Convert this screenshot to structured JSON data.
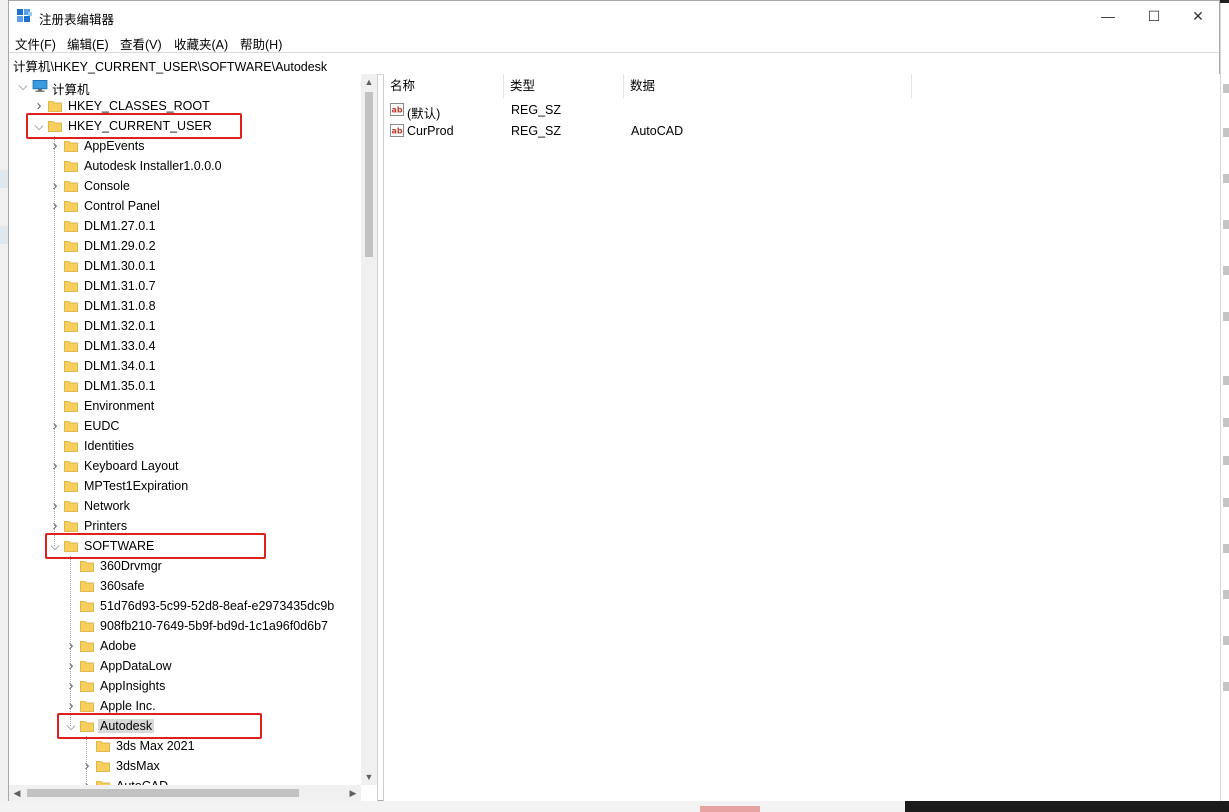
{
  "window": {
    "title": "注册表编辑器",
    "controls": {
      "minimize": "—",
      "maximize": "☐",
      "close": "✕"
    }
  },
  "menu": [
    "文件(F)",
    "编辑(E)",
    "查看(V)",
    "收藏夹(A)",
    "帮助(H)"
  ],
  "address": "计算机\\HKEY_CURRENT_USER\\SOFTWARE\\Autodesk",
  "tree": {
    "root": "计算机",
    "hives": {
      "classes_root": "HKEY_CLASSES_ROOT",
      "current_user": "HKEY_CURRENT_USER"
    },
    "current_user_children": [
      {
        "label": "AppEvents",
        "expandable": true
      },
      {
        "label": "Autodesk Installer1.0.0.0",
        "expandable": false
      },
      {
        "label": "Console",
        "expandable": true
      },
      {
        "label": "Control Panel",
        "expandable": true
      },
      {
        "label": "DLM1.27.0.1",
        "expandable": false
      },
      {
        "label": "DLM1.29.0.2",
        "expandable": false
      },
      {
        "label": "DLM1.30.0.1",
        "expandable": false
      },
      {
        "label": "DLM1.31.0.7",
        "expandable": false
      },
      {
        "label": "DLM1.31.0.8",
        "expandable": false
      },
      {
        "label": "DLM1.32.0.1",
        "expandable": false
      },
      {
        "label": "DLM1.33.0.4",
        "expandable": false
      },
      {
        "label": "DLM1.34.0.1",
        "expandable": false
      },
      {
        "label": "DLM1.35.0.1",
        "expandable": false
      },
      {
        "label": "Environment",
        "expandable": false
      },
      {
        "label": "EUDC",
        "expandable": true
      },
      {
        "label": "Identities",
        "expandable": false
      },
      {
        "label": "Keyboard Layout",
        "expandable": true
      },
      {
        "label": "MPTest1Expiration",
        "expandable": false
      },
      {
        "label": "Network",
        "expandable": true
      },
      {
        "label": "Printers",
        "expandable": true
      }
    ],
    "software": "SOFTWARE",
    "software_children": [
      {
        "label": "360Drvmgr",
        "expandable": false
      },
      {
        "label": "360safe",
        "expandable": false
      },
      {
        "label": "51d76d93-5c99-52d8-8eaf-e2973435dc9b",
        "expandable": false
      },
      {
        "label": "908fb210-7649-5b9f-bd9d-1c1a96f0d6b7",
        "expandable": false
      },
      {
        "label": "Adobe",
        "expandable": true
      },
      {
        "label": "AppDataLow",
        "expandable": true
      },
      {
        "label": "AppInsights",
        "expandable": true
      },
      {
        "label": "Apple Inc.",
        "expandable": true
      }
    ],
    "autodesk": "Autodesk",
    "autodesk_children": [
      {
        "label": "3ds Max 2021",
        "expandable": false
      },
      {
        "label": "3dsMax",
        "expandable": true
      },
      {
        "label": "AutoCAD",
        "expandable": true
      }
    ]
  },
  "list": {
    "columns": [
      "名称",
      "类型",
      "数据"
    ],
    "rows": [
      {
        "name": "(默认)",
        "type": "REG_SZ",
        "data": ""
      },
      {
        "name": "CurProd",
        "type": "REG_SZ",
        "data": "AutoCAD"
      }
    ]
  },
  "colors": {
    "highlight_box": "#e0201c",
    "folder": "#f6cf5d",
    "selection": "#d9d9d9"
  },
  "icons": [
    "registry-editor-icon",
    "computer-icon",
    "folder-icon",
    "string-value-icon",
    "chevron-right-icon",
    "chevron-down-icon"
  ]
}
